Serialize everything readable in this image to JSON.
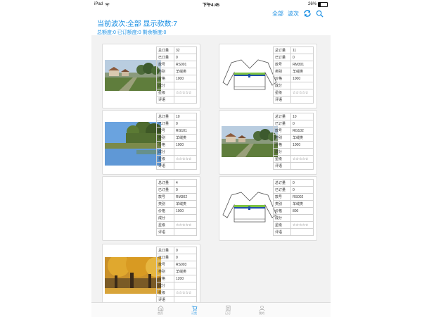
{
  "status": {
    "device": "iPad",
    "wifi_icon": "wifi-icon",
    "time": "下午4:45",
    "battery": "26%"
  },
  "nav": {
    "all_label": "全部",
    "wave_label": "波次",
    "refresh_icon": "refresh-icon",
    "search_icon": "search-icon"
  },
  "header": {
    "title": "当前波次:全部  显示款数:7",
    "subtitle": "总额度:0 已订额度:0 剩余额度:0"
  },
  "field_labels": [
    "总订量",
    "已订量",
    "款号",
    "类别",
    "价格",
    "成分",
    "星级",
    "评语"
  ],
  "products": [
    {
      "total": "32",
      "ordered": "0",
      "code": "RS001",
      "category": "羊绒类",
      "price": "1000",
      "material": "",
      "rating": "☆☆☆☆☆",
      "comment": "",
      "image": "landscape-photo"
    },
    {
      "total": "11",
      "ordered": "0",
      "code": "RM301",
      "category": "羊绒类",
      "price": "1000",
      "material": "",
      "rating": "☆☆☆☆☆",
      "comment": "",
      "image": "sweater-sketch"
    },
    {
      "total": "10",
      "ordered": "0",
      "code": "RG101",
      "category": "羊绒类",
      "price": "1000",
      "material": "",
      "rating": "☆☆☆☆☆",
      "comment": "",
      "image": "lake-photo"
    },
    {
      "total": "10",
      "ordered": "0",
      "code": "RG102",
      "category": "羊绒类",
      "price": "1000",
      "material": "",
      "rating": "☆☆☆☆☆",
      "comment": "",
      "image": "landscape-photo"
    },
    {
      "total": "4",
      "ordered": "0",
      "code": "RM302",
      "category": "羊绒类",
      "price": "1000",
      "material": "",
      "rating": "☆☆☆☆☆",
      "comment": "",
      "image": "none"
    },
    {
      "total": "0",
      "ordered": "0",
      "code": "RS002",
      "category": "羊绒类",
      "price": "800",
      "material": "",
      "rating": "☆☆☆☆☆",
      "comment": "",
      "image": "sweater-sketch"
    },
    {
      "total": "0",
      "ordered": "0",
      "code": "RS003",
      "category": "羊绒类",
      "price": "1200",
      "material": "",
      "rating": "☆☆☆☆☆",
      "comment": "",
      "image": "autumn-tree-photo"
    }
  ],
  "tabs": [
    {
      "label": "首页",
      "icon": "home-icon",
      "active": false
    },
    {
      "label": "订货",
      "icon": "cart-icon",
      "active": true
    },
    {
      "label": "已订",
      "icon": "clipboard-icon",
      "active": false
    },
    {
      "label": "我的",
      "icon": "user-icon",
      "active": false
    }
  ],
  "colors": {
    "accent": "#1a8fe3",
    "background": "#f2f2f2",
    "stripe_green": "#7cc242",
    "stripe_blue": "#1f4fa8"
  }
}
